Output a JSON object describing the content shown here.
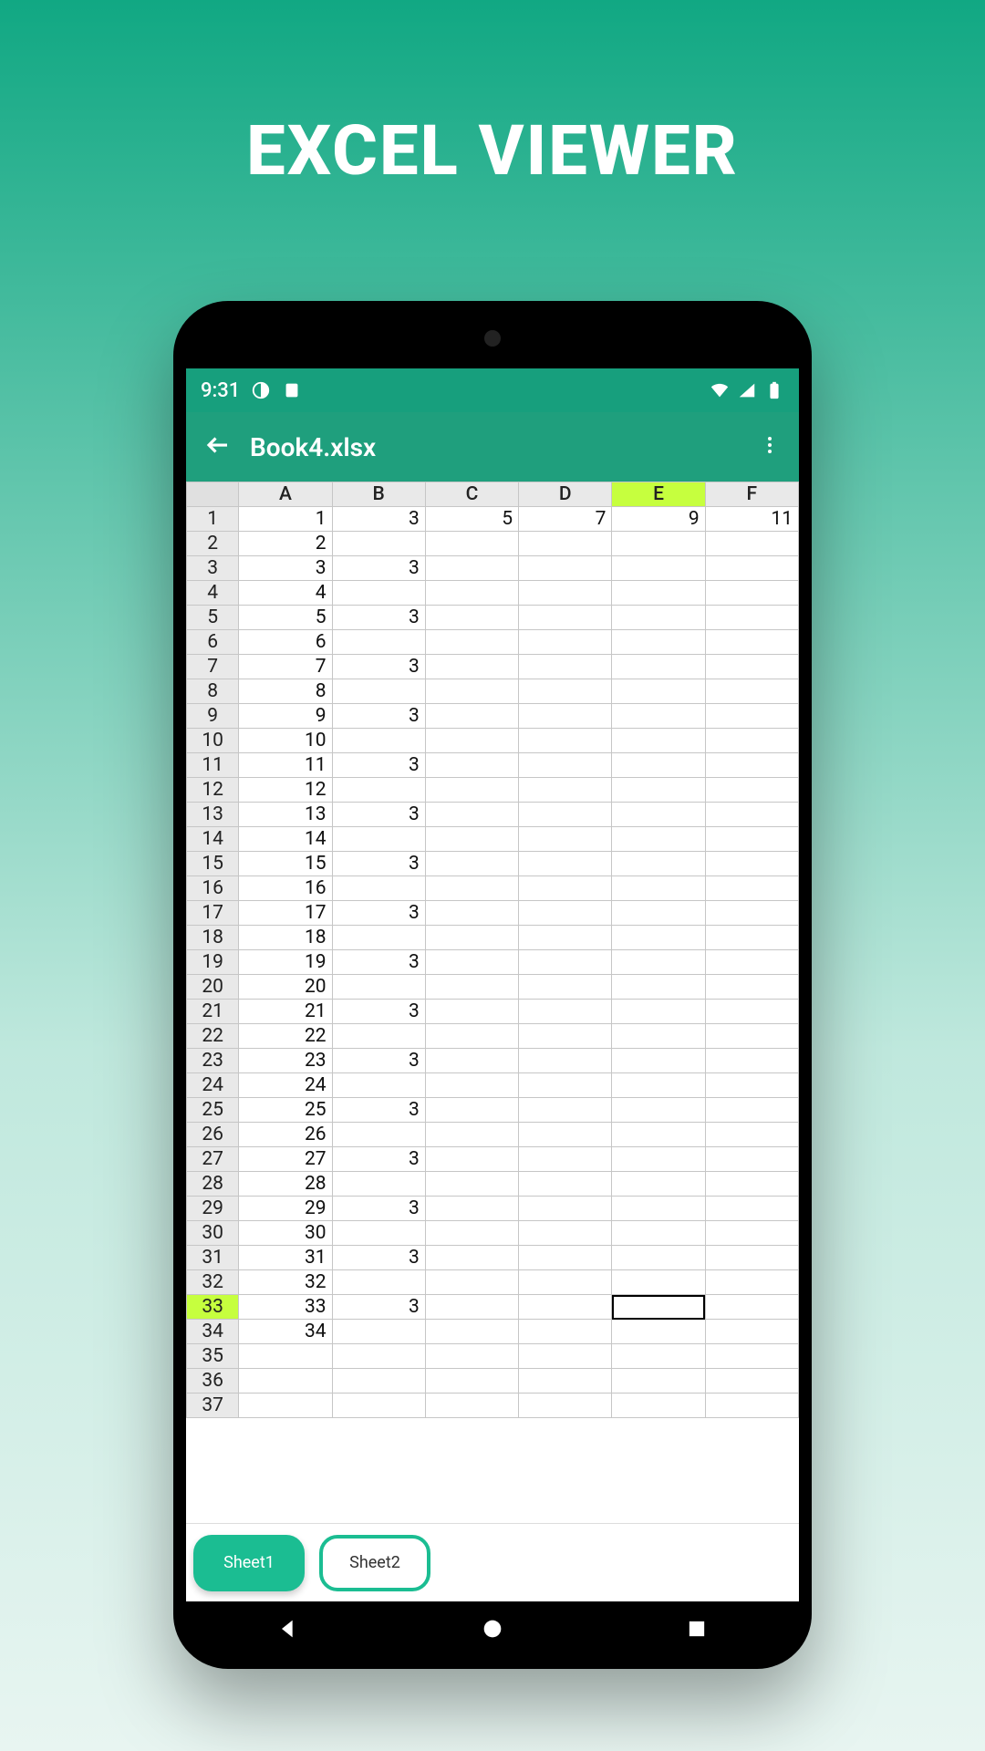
{
  "promo": {
    "title": "EXCEL VIEWER"
  },
  "statusbar": {
    "time": "9:31"
  },
  "appbar": {
    "title": "Book4.xlsx"
  },
  "chart_data": {
    "type": "table",
    "columns": [
      "A",
      "B",
      "C",
      "D",
      "E",
      "F"
    ],
    "row_count": 37,
    "rows": [
      {
        "n": 1,
        "A": "1",
        "B": "3",
        "C": "5",
        "D": "7",
        "E": "9",
        "F": "11"
      },
      {
        "n": 2,
        "A": "2",
        "B": "",
        "C": "",
        "D": "",
        "E": "",
        "F": ""
      },
      {
        "n": 3,
        "A": "3",
        "B": "3",
        "C": "",
        "D": "",
        "E": "",
        "F": ""
      },
      {
        "n": 4,
        "A": "4",
        "B": "",
        "C": "",
        "D": "",
        "E": "",
        "F": ""
      },
      {
        "n": 5,
        "A": "5",
        "B": "3",
        "C": "",
        "D": "",
        "E": "",
        "F": ""
      },
      {
        "n": 6,
        "A": "6",
        "B": "",
        "C": "",
        "D": "",
        "E": "",
        "F": ""
      },
      {
        "n": 7,
        "A": "7",
        "B": "3",
        "C": "",
        "D": "",
        "E": "",
        "F": ""
      },
      {
        "n": 8,
        "A": "8",
        "B": "",
        "C": "",
        "D": "",
        "E": "",
        "F": ""
      },
      {
        "n": 9,
        "A": "9",
        "B": "3",
        "C": "",
        "D": "",
        "E": "",
        "F": ""
      },
      {
        "n": 10,
        "A": "10",
        "B": "",
        "C": "",
        "D": "",
        "E": "",
        "F": ""
      },
      {
        "n": 11,
        "A": "11",
        "B": "3",
        "C": "",
        "D": "",
        "E": "",
        "F": ""
      },
      {
        "n": 12,
        "A": "12",
        "B": "",
        "C": "",
        "D": "",
        "E": "",
        "F": ""
      },
      {
        "n": 13,
        "A": "13",
        "B": "3",
        "C": "",
        "D": "",
        "E": "",
        "F": ""
      },
      {
        "n": 14,
        "A": "14",
        "B": "",
        "C": "",
        "D": "",
        "E": "",
        "F": ""
      },
      {
        "n": 15,
        "A": "15",
        "B": "3",
        "C": "",
        "D": "",
        "E": "",
        "F": ""
      },
      {
        "n": 16,
        "A": "16",
        "B": "",
        "C": "",
        "D": "",
        "E": "",
        "F": ""
      },
      {
        "n": 17,
        "A": "17",
        "B": "3",
        "C": "",
        "D": "",
        "E": "",
        "F": ""
      },
      {
        "n": 18,
        "A": "18",
        "B": "",
        "C": "",
        "D": "",
        "E": "",
        "F": ""
      },
      {
        "n": 19,
        "A": "19",
        "B": "3",
        "C": "",
        "D": "",
        "E": "",
        "F": ""
      },
      {
        "n": 20,
        "A": "20",
        "B": "",
        "C": "",
        "D": "",
        "E": "",
        "F": ""
      },
      {
        "n": 21,
        "A": "21",
        "B": "3",
        "C": "",
        "D": "",
        "E": "",
        "F": ""
      },
      {
        "n": 22,
        "A": "22",
        "B": "",
        "C": "",
        "D": "",
        "E": "",
        "F": ""
      },
      {
        "n": 23,
        "A": "23",
        "B": "3",
        "C": "",
        "D": "",
        "E": "",
        "F": ""
      },
      {
        "n": 24,
        "A": "24",
        "B": "",
        "C": "",
        "D": "",
        "E": "",
        "F": ""
      },
      {
        "n": 25,
        "A": "25",
        "B": "3",
        "C": "",
        "D": "",
        "E": "",
        "F": ""
      },
      {
        "n": 26,
        "A": "26",
        "B": "",
        "C": "",
        "D": "",
        "E": "",
        "F": ""
      },
      {
        "n": 27,
        "A": "27",
        "B": "3",
        "C": "",
        "D": "",
        "E": "",
        "F": ""
      },
      {
        "n": 28,
        "A": "28",
        "B": "",
        "C": "",
        "D": "",
        "E": "",
        "F": ""
      },
      {
        "n": 29,
        "A": "29",
        "B": "3",
        "C": "",
        "D": "",
        "E": "",
        "F": ""
      },
      {
        "n": 30,
        "A": "30",
        "B": "",
        "C": "",
        "D": "",
        "E": "",
        "F": ""
      },
      {
        "n": 31,
        "A": "31",
        "B": "3",
        "C": "",
        "D": "",
        "E": "",
        "F": ""
      },
      {
        "n": 32,
        "A": "32",
        "B": "",
        "C": "",
        "D": "",
        "E": "",
        "F": ""
      },
      {
        "n": 33,
        "A": "33",
        "B": "3",
        "C": "",
        "D": "",
        "E": "",
        "F": ""
      },
      {
        "n": 34,
        "A": "34",
        "B": "",
        "C": "",
        "D": "",
        "E": "",
        "F": ""
      },
      {
        "n": 35,
        "A": "",
        "B": "",
        "C": "",
        "D": "",
        "E": "",
        "F": ""
      },
      {
        "n": 36,
        "A": "",
        "B": "",
        "C": "",
        "D": "",
        "E": "",
        "F": ""
      },
      {
        "n": 37,
        "A": "",
        "B": "",
        "C": "",
        "D": "",
        "E": "",
        "F": ""
      }
    ],
    "active_cell": {
      "row": 33,
      "col": "E"
    }
  },
  "tabs": [
    {
      "label": "Sheet1",
      "active": true
    },
    {
      "label": "Sheet2",
      "active": false
    }
  ]
}
